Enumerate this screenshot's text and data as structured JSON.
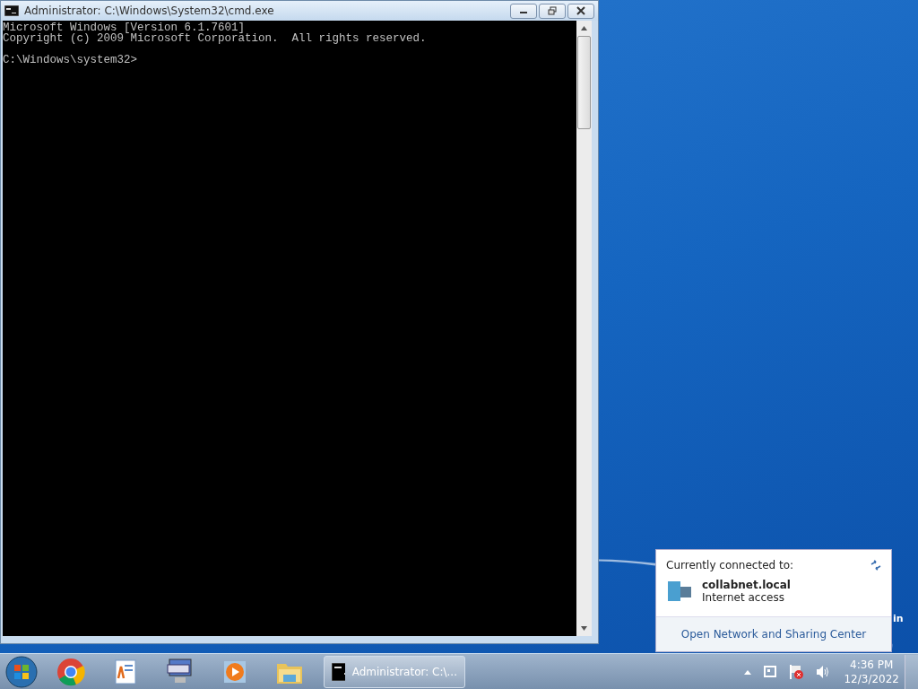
{
  "window": {
    "title": "Administrator: C:\\Windows\\System32\\cmd.exe"
  },
  "console": {
    "banner": [
      "Microsoft Windows [Version 6.1.7601]",
      "Copyright (c) 2009 Microsoft Corporation.  All rights reserved."
    ],
    "prompt": "C:\\Windows\\system32>"
  },
  "desktop": {
    "partial_text": "in"
  },
  "network_popup": {
    "heading": "Currently connected to:",
    "network_name": "collabnet.local",
    "access": "Internet access",
    "link": "Open Network and Sharing Center"
  },
  "taskbar": {
    "pinned": [
      {
        "kind": "chrome"
      },
      {
        "kind": "wordpad"
      },
      {
        "kind": "keyboard"
      },
      {
        "kind": "media"
      },
      {
        "kind": "folder"
      }
    ],
    "active_task": {
      "label": "Administrator: C:\\..."
    },
    "clock": {
      "time": "4:36 PM",
      "date": "12/3/2022"
    }
  }
}
